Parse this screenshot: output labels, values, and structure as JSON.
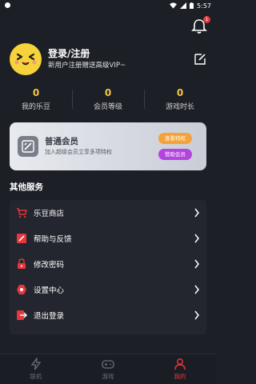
{
  "status_bar": {
    "time": "5:57"
  },
  "notifications": {
    "badge": "1"
  },
  "profile": {
    "title": "登录/注册",
    "subtitle": "新用户注册赠送高级VIP~"
  },
  "stats": [
    {
      "value": "0",
      "label": "我的乐豆"
    },
    {
      "value": "0",
      "label": "会员等级"
    },
    {
      "value": "0",
      "label": "游戏时长"
    }
  ],
  "vip_card": {
    "title": "普通会员",
    "subtitle": "加入超级会员立享多项特权",
    "privileges_button": "查看特权",
    "sponsor_button": "赞助会员"
  },
  "services": {
    "title": "其他服务",
    "items": [
      {
        "label": "乐豆商店",
        "icon": "cart-icon"
      },
      {
        "label": "帮助与反馈",
        "icon": "edit-icon"
      },
      {
        "label": "修改密码",
        "icon": "lock-icon"
      },
      {
        "label": "设置中心",
        "icon": "settings-icon"
      },
      {
        "label": "退出登录",
        "icon": "logout-icon"
      }
    ]
  },
  "bottom_nav": [
    {
      "label": "联机",
      "active": false
    },
    {
      "label": "游戏",
      "active": false
    },
    {
      "label": "我的",
      "active": true
    }
  ],
  "colors": {
    "accent": "#e8363c",
    "stat_value": "#f6c643",
    "privileges_button": "#f4a239",
    "sponsor_button": "#b444e0"
  }
}
